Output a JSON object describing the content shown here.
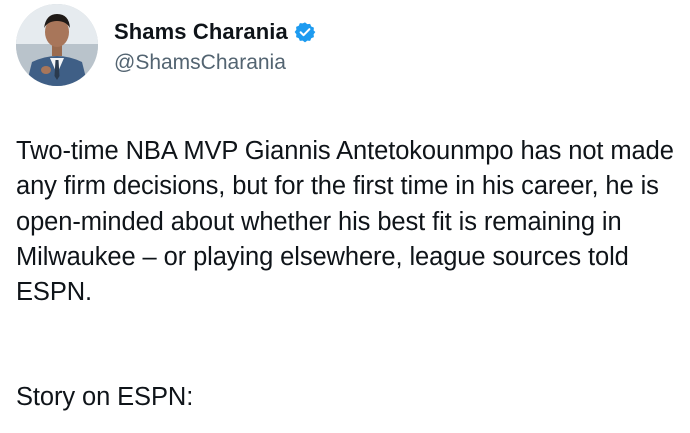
{
  "author": {
    "display_name": "Shams Charania",
    "handle": "@ShamsCharania",
    "verified_color": "#1d9bf0"
  },
  "tweet": {
    "text": "Two-time NBA MVP Giannis Antetokounmpo has not made any firm decisions, but for the first time in his career, he is open-minded about whether his best fit is remaining in Milwaukee – or playing elsewhere, league sources told ESPN.",
    "story_line": "Story on ESPN:"
  },
  "icons": {
    "avatar": "profile-photo",
    "verified": "verified-badge-icon"
  }
}
